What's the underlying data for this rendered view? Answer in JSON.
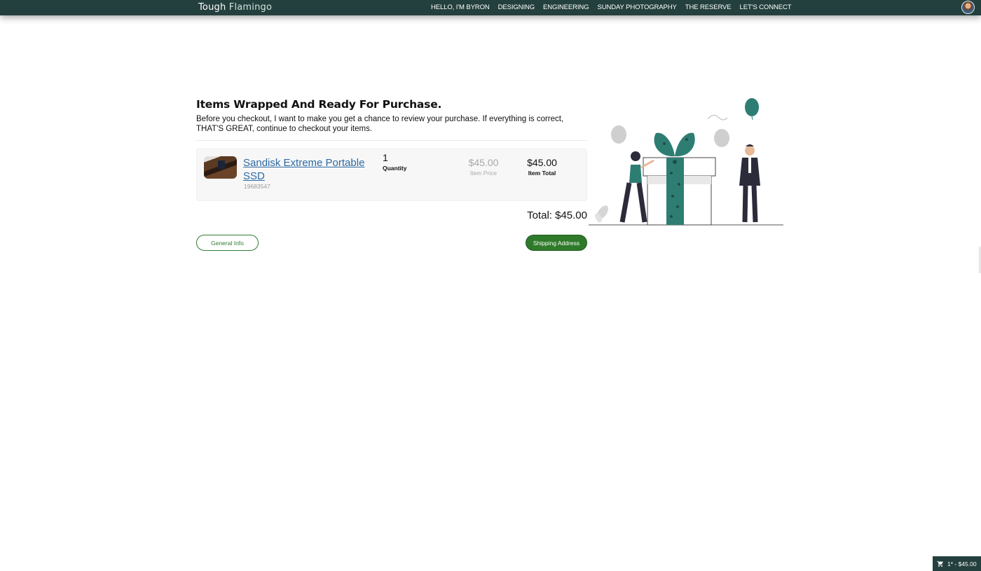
{
  "brand": {
    "part1": "Tough",
    "part2": "Flamingo"
  },
  "nav": {
    "items": [
      {
        "label": "HELLO, I'M BYRON"
      },
      {
        "label": "DESIGNING"
      },
      {
        "label": "ENGINEERING"
      },
      {
        "label": "SUNDAY PHOTOGRAPHY"
      },
      {
        "label": "THE RESERVE"
      },
      {
        "label": "LET'S CONNECT"
      }
    ]
  },
  "page": {
    "heading": "Items Wrapped And Ready For Purchase.",
    "intro": "Before you checkout, I want to make you get a chance to review your purchase. If everything is correct, THAT'S GREAT, continue to checkout your items."
  },
  "item": {
    "name": "Sandisk Extreme Portable SSD",
    "sku": "19683547",
    "quantity": "1",
    "quantity_label": "Quantity",
    "price": "$45.00",
    "price_label": "Item Price",
    "total": "$45.00",
    "total_label": "Item Total"
  },
  "summary": {
    "total": "Total: $45.00"
  },
  "buttons": {
    "back": "General Info",
    "next": "Shipping Address"
  },
  "cart": {
    "label": "1* - $45.00",
    "icon": "cart-icon"
  },
  "colors": {
    "header": "#24403e",
    "accent": "#2f7a2a",
    "link": "#2d6aa3",
    "illustration": "#2e7d73"
  }
}
